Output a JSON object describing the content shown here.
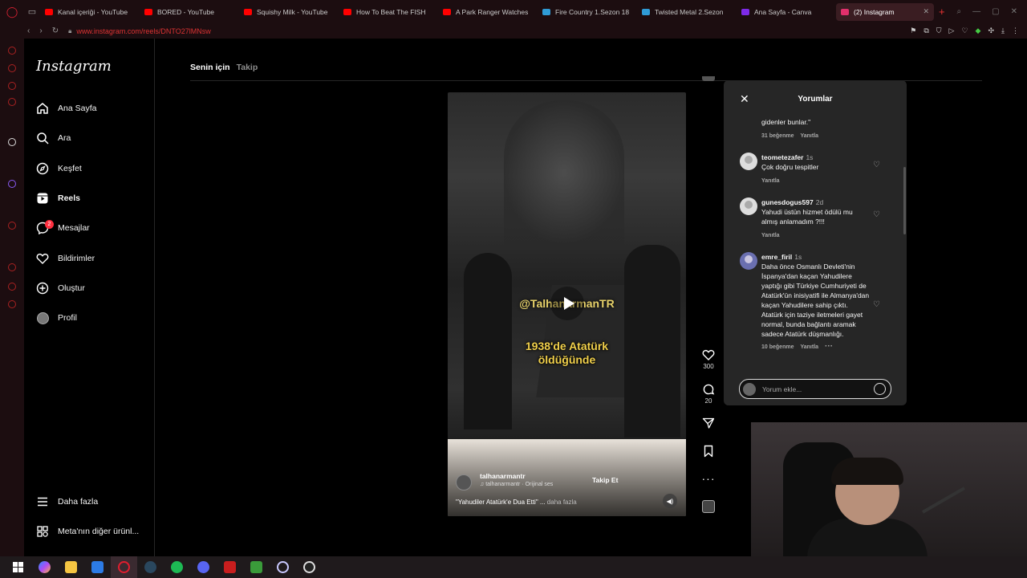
{
  "browser": {
    "tabs": [
      {
        "label": "Kanal içeriği - YouTube",
        "color": "#ff0000"
      },
      {
        "label": "BORED - YouTube",
        "color": "#ff0000"
      },
      {
        "label": "Squishy Milk - YouTube",
        "color": "#ff0000"
      },
      {
        "label": "How To Beat The FISH",
        "color": "#ff0000"
      },
      {
        "label": "A Park Ranger Watches",
        "color": "#ff0000"
      },
      {
        "label": "Fire Country 1.Sezon 18",
        "color": "#2f9bd6"
      },
      {
        "label": "Twisted Metal 2.Sezon",
        "color": "#2f9bd6"
      },
      {
        "label": "Ana Sayfa - Canva",
        "color": "#7d2ae8"
      },
      {
        "label": "(2) Instagram",
        "color": "#e1306c"
      }
    ],
    "url": "www.instagram.com/reels/DNTO27lMNsw"
  },
  "sidebar": {
    "logo": "Instagram",
    "items": [
      {
        "label": "Ana Sayfa",
        "icon": "home-icon"
      },
      {
        "label": "Ara",
        "icon": "search-icon"
      },
      {
        "label": "Keşfet",
        "icon": "compass-icon"
      },
      {
        "label": "Reels",
        "icon": "reels-icon"
      },
      {
        "label": "Mesajlar",
        "icon": "messenger-icon",
        "badge": "2"
      },
      {
        "label": "Bildirimler",
        "icon": "heart-icon"
      },
      {
        "label": "Oluştur",
        "icon": "plus-icon"
      },
      {
        "label": "Profil",
        "icon": "avatar"
      }
    ],
    "more": "Daha fazla",
    "meta": "Meta'nın diğer ürünl..."
  },
  "feed_tabs": {
    "for_you": "Senin için",
    "following": "Takip"
  },
  "reel": {
    "watermark": "@TalhanarmanTR",
    "caption": "1938'de Atatürk\nöldüğünde",
    "username": "talhanarmantr",
    "audio": "talhanarmantr · Orijinal ses",
    "follow": "Takip Et",
    "description": "\"Yahudiler Atatürk'e Dua Etti\" ...",
    "more": "daha fazla",
    "likes": "300",
    "comments_count": "20"
  },
  "comments_panel": {
    "title": "Yorumlar",
    "items": [
      {
        "user": "",
        "time": "",
        "text": "gidenler bunlar.\"",
        "likes": "31 beğenme",
        "reply": "Yanıtla"
      },
      {
        "user": "teometezafer",
        "time": "1s",
        "text": "Çok doğru tespitler",
        "likes": "",
        "reply": "Yanıtla"
      },
      {
        "user": "gunesdogus597",
        "time": "2d",
        "text": "Yahudi üstün hizmet ödülü mu almış anlamadım ?!!!",
        "likes": "",
        "reply": "Yanıtla"
      },
      {
        "user": "emre_firil",
        "time": "1s",
        "text": "Daha önce Osmanlı Devleti'nin İspanya'dan kaçan Yahudilere yaptığı gibi Türkiye Cumhuriyeti de Atatürk'ün inisiyatifi ile Almanya'dan kaçan Yahudilere sahip çıktı. Atatürk için taziye iletmeleri gayet normal, bunda bağlantı aramak sadece Atatürk düşmanlığı.",
        "likes": "10 beğenme",
        "reply": "Yanıtla"
      }
    ],
    "input_placeholder": "Yorum ekle..."
  }
}
